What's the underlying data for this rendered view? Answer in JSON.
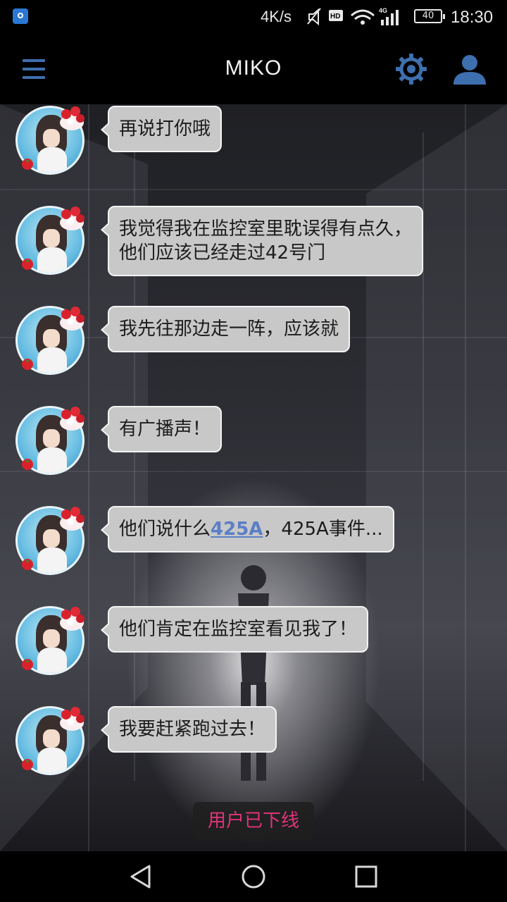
{
  "status_bar": {
    "speed": "4K/s",
    "network": "4G",
    "battery": "40",
    "time": "18:30"
  },
  "header": {
    "title": "MIKO",
    "menu_icon": "hamburger-menu-icon",
    "settings_icon": "gear-icon",
    "profile_icon": "user-icon"
  },
  "messages": [
    {
      "lines": [
        "再说打你哦"
      ]
    },
    {
      "lines": [
        "我觉得我在监控室里耽误得有点久，",
        "他们应该已经走过42号门"
      ]
    },
    {
      "lines": [
        "我先往那边走一阵，应该就"
      ]
    },
    {
      "lines": [
        "有广播声！"
      ]
    },
    {
      "before": "他们说什么",
      "link": "425A",
      "after": "，425A事件..."
    },
    {
      "lines": [
        "他们肯定在监控室看见我了！"
      ]
    },
    {
      "lines": [
        "我要赶紧跑过去！"
      ]
    }
  ],
  "toast": "用户已下线",
  "colors": {
    "accent": "#3e6fae",
    "bubble": "#c8c8c8",
    "link": "#5b7fc7",
    "toast_text": "#e0337a"
  }
}
